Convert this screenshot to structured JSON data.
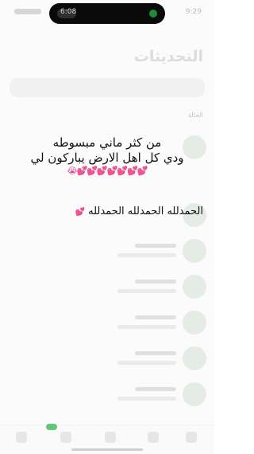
{
  "status_bar": {
    "time": "9:29",
    "island_label": "6:08"
  },
  "header": {
    "title": "التحديثات"
  },
  "section": {
    "label": "الحالة"
  },
  "overlay": {
    "line1": "من كثر ماني مبسوطه",
    "line2": "ودي كل اهل الارض يباركون لي",
    "emojis": "💕💕💕💕💕💕💕😭",
    "line3": "الحمدلله الحمدلله الحمدلله",
    "line3_emoji": "💕"
  },
  "bottom_nav": {
    "items": [
      "updates-tab",
      "calls-tab",
      "communities-tab",
      "chats-tab",
      "settings-tab"
    ]
  }
}
